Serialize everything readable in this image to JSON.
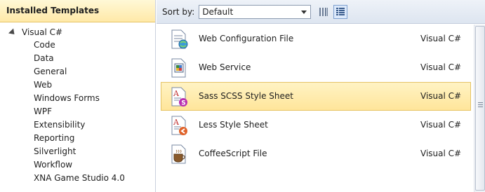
{
  "left_panel": {
    "header": "Installed Templates",
    "root": "Visual C#",
    "items": [
      {
        "label": "Code"
      },
      {
        "label": "Data"
      },
      {
        "label": "General"
      },
      {
        "label": "Web"
      },
      {
        "label": "Windows Forms"
      },
      {
        "label": "WPF"
      },
      {
        "label": "Extensibility"
      },
      {
        "label": "Reporting"
      },
      {
        "label": "Silverlight"
      },
      {
        "label": "Workflow"
      },
      {
        "label": "XNA Game Studio 4.0"
      }
    ]
  },
  "toolbar": {
    "sort_label": "Sort by:",
    "sort_value": "Default"
  },
  "templates": [
    {
      "name": "Web Configuration File",
      "lang": "Visual C#",
      "icon": "web-config-icon"
    },
    {
      "name": "Web Service",
      "lang": "Visual C#",
      "icon": "web-service-icon"
    },
    {
      "name": "Sass SCSS Style Sheet",
      "lang": "Visual C#",
      "icon": "sass-stylesheet-icon"
    },
    {
      "name": "Less Style Sheet",
      "lang": "Visual C#",
      "icon": "less-stylesheet-icon"
    },
    {
      "name": "CoffeeScript File",
      "lang": "Visual C#",
      "icon": "coffeescript-icon"
    }
  ],
  "colors": {
    "selection": "#ffe59a",
    "sass_badge": "#b92fb0",
    "less_badge": "#e0632a"
  }
}
